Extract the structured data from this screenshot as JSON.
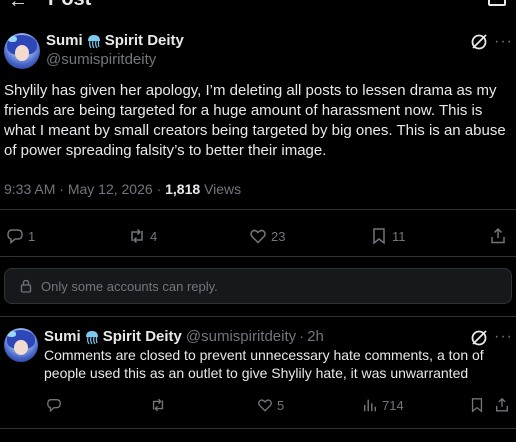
{
  "header": {
    "title": "Post"
  },
  "post": {
    "author": {
      "display_name": "Sumi",
      "display_name_suffix": "Spirit Deity",
      "handle": "@sumispiritdeity"
    },
    "text": "Shylily has given her apology, I’m deleting all posts to lessen drama as my friends are being targeted for a huge amount of harassment now. This is what I meant by small creators being targeted by big ones. This is an abuse of power spreading falsity’s to better their image.",
    "time": "9:33 AM",
    "separator": "·",
    "date": "May 12, 2026",
    "views_count": "1,818",
    "views_label": "Views",
    "actions": {
      "replies": "1",
      "reposts": "4",
      "likes": "23",
      "bookmarks": "11"
    }
  },
  "reply_restriction": {
    "text": "Only some accounts can reply."
  },
  "reply": {
    "author": {
      "display_name": "Sumi",
      "display_name_suffix": "Spirit Deity",
      "handle": "@sumispiritdeity",
      "time": "2h"
    },
    "separator": "·",
    "text": "Comments are closed to prevent unnecessary hate comments, a ton of people used this as an outlet to give Shylily hate, it was unwarranted",
    "actions": {
      "replies": "",
      "reposts": "",
      "likes": "5",
      "views": "714"
    }
  },
  "colors": {
    "background": "#000000",
    "text": "#e7e9ea",
    "muted": "#71767b",
    "border": "#2f3336"
  }
}
